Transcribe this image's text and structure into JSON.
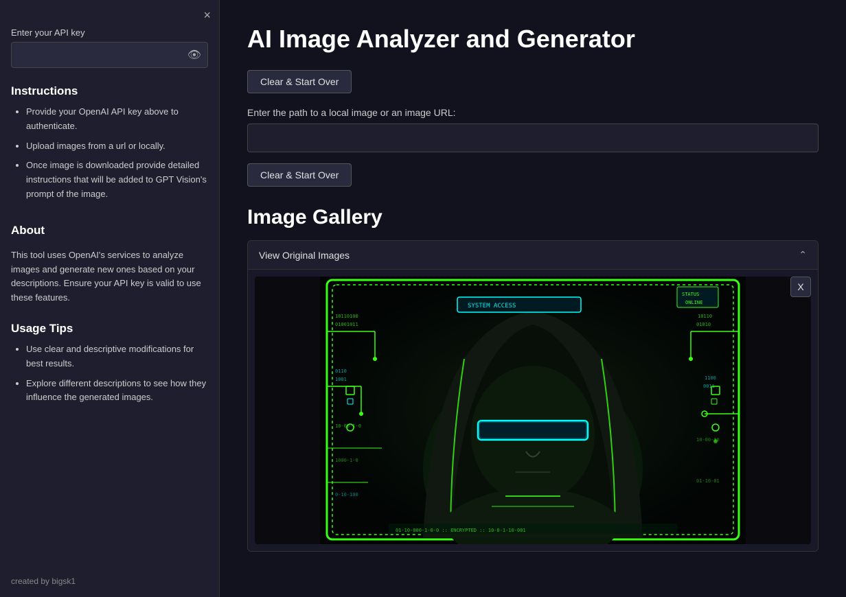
{
  "sidebar": {
    "close_icon": "×",
    "api_key_label": "Enter your API key",
    "api_key_value": "",
    "api_key_placeholder": "",
    "eye_icon": "👁",
    "instructions_title": "Instructions",
    "instructions_items": [
      "Provide your OpenAI API key above to authenticate.",
      "Upload images from a url or locally.",
      "Once image is downloaded provide detailed instructions that will be added to GPT Vision's prompt of the image."
    ],
    "about_title": "About",
    "about_text": "This tool uses OpenAI's services to analyze images and generate new ones based on your descriptions. Ensure your API key is valid to use these features.",
    "usage_tips_title": "Usage Tips",
    "usage_tips_items": [
      "Use clear and descriptive modifications for best results.",
      "Explore different descriptions to see how they influence the generated images."
    ],
    "created_by": "created by bigsk1"
  },
  "main": {
    "page_title": "AI Image Analyzer and Generator",
    "clear_btn_top_label": "Clear & Start Over",
    "image_path_label": "Enter the path to a local image or an image URL:",
    "image_url_placeholder": "",
    "clear_btn_bottom_label": "Clear & Start Over",
    "image_gallery_title": "Image Gallery",
    "gallery_view_label": "View Original Images",
    "close_image_btn_label": "X"
  }
}
